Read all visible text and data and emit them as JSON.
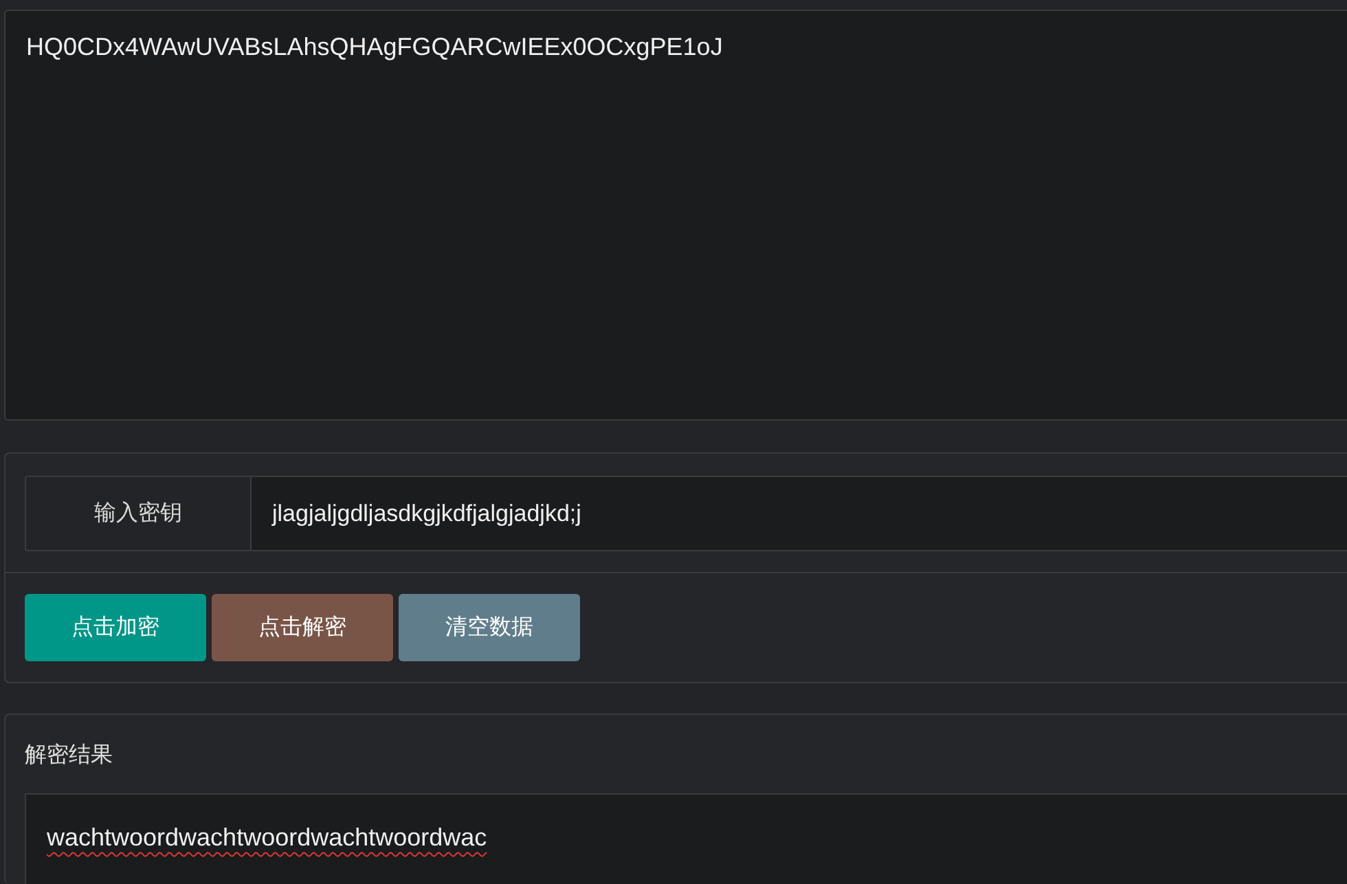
{
  "cipher_field": {
    "value": "HQ0CDx4WAwUVABsLAhsQHAgFGQARCwIEEx0OCxgPE1oJ"
  },
  "key_input": {
    "label": "输入密钥",
    "value": "jlagjaljgdljasdkgjkdfjalgjadjkd;j"
  },
  "buttons": [
    {
      "label": "点击加密",
      "kind": "encrypt"
    },
    {
      "label": "点击解密",
      "kind": "decrypt"
    },
    {
      "label": "清空数据",
      "kind": "clear"
    }
  ],
  "result": {
    "title": "解密结果",
    "value": "wachtwoordwachtwoordwachtwoordwac",
    "misspelled": true
  }
}
